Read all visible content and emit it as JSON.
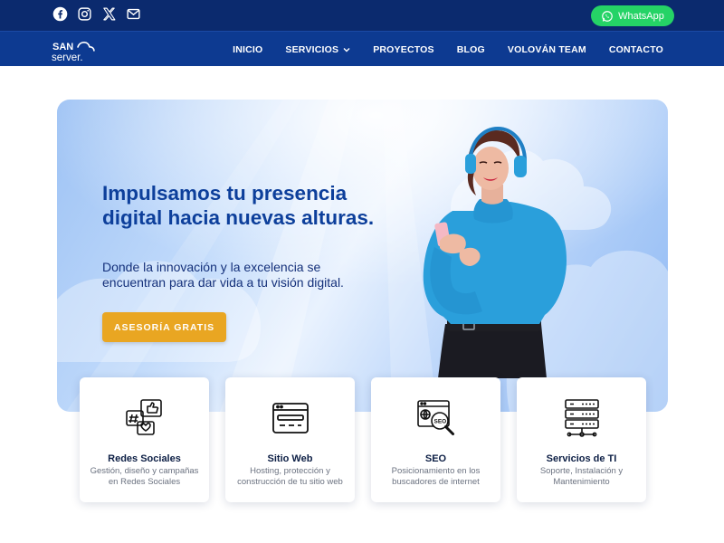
{
  "topbar": {
    "social_icons": [
      "facebook-icon",
      "instagram-icon",
      "x-icon",
      "mail-icon"
    ],
    "whatsapp_label": "WhatsApp"
  },
  "brand": {
    "logo_line1": "SAN",
    "logo_line2": "server."
  },
  "nav": {
    "items": [
      "INICIO",
      "SERVICIOS",
      "PROYECTOS",
      "BLOG",
      "VOLOVÁN TEAM",
      "CONTACTO"
    ]
  },
  "hero": {
    "headline": "Impulsamos tu presencia digital hacia nuevas alturas.",
    "subtitle": "Donde la innovación y la excelencia se encuentran para dar vida a tu visión digital.",
    "cta_label": "ASESORÍA GRATIS"
  },
  "services": [
    {
      "icon": "social-media-icon",
      "title": "Redes Sociales",
      "description": "Gestión, diseño y campañas en Redes Sociales"
    },
    {
      "icon": "website-icon",
      "title": "Sitio Web",
      "description": "Hosting, protección y construcción de tu sitio web"
    },
    {
      "icon": "seo-icon",
      "title": "SEO",
      "description": "Posicionamiento en los buscadores de internet"
    },
    {
      "icon": "server-icon",
      "title": "Servicios de TI",
      "description": "Soporte, Instalación y Mantenimiento"
    }
  ],
  "colors": {
    "topbar": "#0b2a6e",
    "navbar": "#0d3a91",
    "headline": "#0d3f9b",
    "cta": "#e9a622",
    "whatsapp": "#25d366"
  }
}
